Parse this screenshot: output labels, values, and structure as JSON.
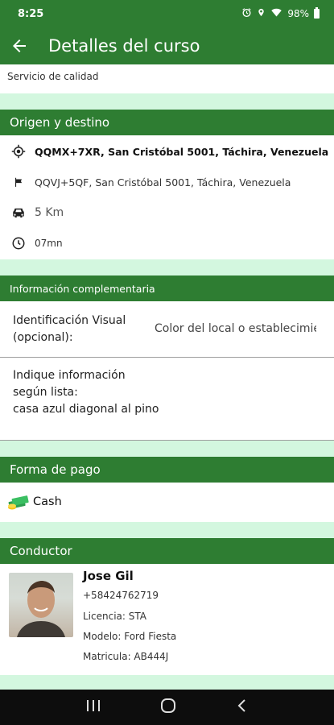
{
  "status_bar": {
    "time": "8:25",
    "battery": "98%"
  },
  "app_bar": {
    "title": "Detalles del curso"
  },
  "service": {
    "label": "Servicio de calidad"
  },
  "route": {
    "header": "Origen y destino",
    "origin": "QQMX+7XR, San Cristóbal 5001, Táchira, Venezuela",
    "destination": "QQVJ+5QF, San Cristóbal 5001, Táchira, Venezuela",
    "distance": "5 Km",
    "duration": "07mn"
  },
  "extra_info": {
    "header": "Información complementaria",
    "visual_id_label_line1": "Identificación Visual",
    "visual_id_label_line2": "(opcional):",
    "visual_id_value": "Color del local o establecimiento",
    "list_info_line1": "Indique información",
    "list_info_line2": "según lista:",
    "list_info_value": "casa azul diagonal al pino"
  },
  "payment": {
    "header": "Forma de pago",
    "method": "Cash"
  },
  "driver": {
    "header": "Conductor",
    "name": "Jose Gil",
    "phone": "+58424762719",
    "license": "Licencia: STA",
    "model": "Modelo: Ford Fiesta",
    "plate": "Matricula: AB444J"
  },
  "colors": {
    "primary": "#2e7d32",
    "band": "#d3f7df"
  },
  "icons": [
    "alarm-icon",
    "location-icon",
    "wifi-icon",
    "battery-icon",
    "back-arrow-icon",
    "gps-target-icon",
    "flag-icon",
    "car-icon",
    "clock-icon",
    "cash-icon",
    "recents-icon",
    "home-icon",
    "nav-back-icon"
  ]
}
